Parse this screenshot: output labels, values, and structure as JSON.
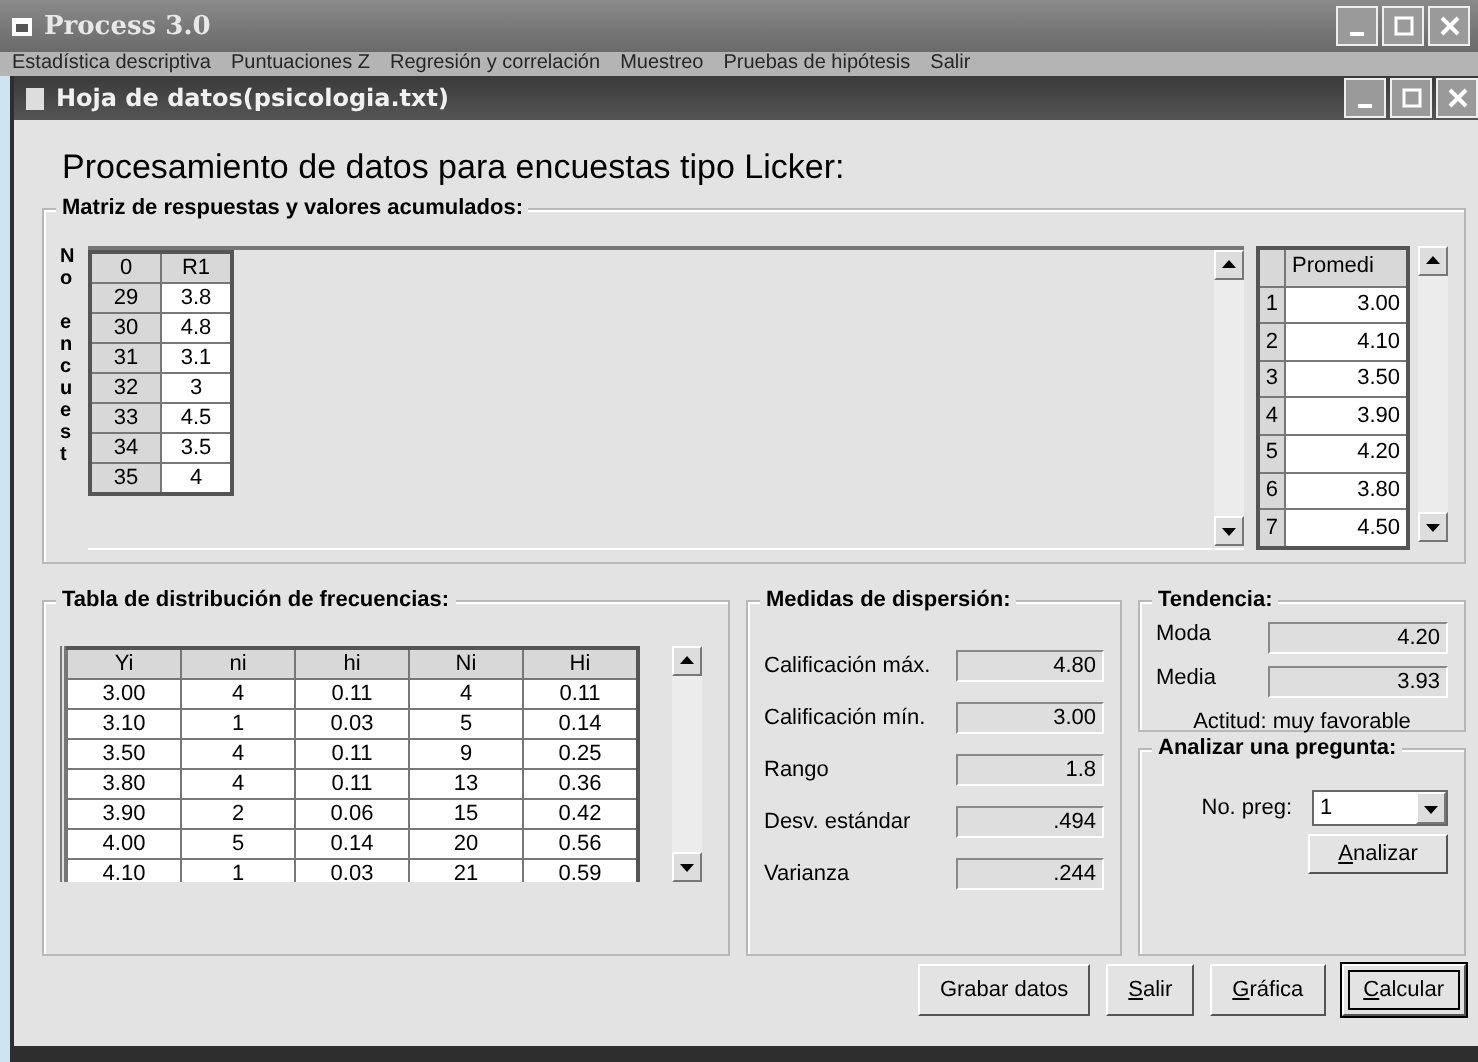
{
  "app_window": {
    "title": "Process 3.0"
  },
  "menu": [
    "Estadística descriptiva",
    "Puntuaciones Z",
    "Regresión y correlación",
    "Muestreo",
    "Pruebas de hipótesis",
    "Salir"
  ],
  "document_window": {
    "title": "Hoja de datos(psicologia.txt)"
  },
  "heading": "Procesamiento de datos para encuestas tipo Licker:",
  "response_matrix": {
    "title": "Matriz de respuestas y valores acumulados:",
    "side_label": "No encuest",
    "columns": [
      "0",
      "R1"
    ],
    "rows": [
      [
        "29",
        "3.8"
      ],
      [
        "30",
        "4.8"
      ],
      [
        "31",
        "3.1"
      ],
      [
        "32",
        "3"
      ],
      [
        "33",
        "4.5"
      ],
      [
        "34",
        "3.5"
      ],
      [
        "35",
        "4"
      ]
    ]
  },
  "averages": {
    "column": "Promedi",
    "rows": [
      [
        "1",
        "3.00"
      ],
      [
        "2",
        "4.10"
      ],
      [
        "3",
        "3.50"
      ],
      [
        "4",
        "3.90"
      ],
      [
        "5",
        "4.20"
      ],
      [
        "6",
        "3.80"
      ],
      [
        "7",
        "4.50"
      ]
    ]
  },
  "frequency_table": {
    "title": "Tabla de distribución de frecuencias:",
    "columns": [
      "Yi",
      "ni",
      "hi",
      "Ni",
      "Hi"
    ],
    "rows": [
      [
        "3.00",
        "4",
        "0.11",
        "4",
        "0.11"
      ],
      [
        "3.10",
        "1",
        "0.03",
        "5",
        "0.14"
      ],
      [
        "3.50",
        "4",
        "0.11",
        "9",
        "0.25"
      ],
      [
        "3.80",
        "4",
        "0.11",
        "13",
        "0.36"
      ],
      [
        "3.90",
        "2",
        "0.06",
        "15",
        "0.42"
      ],
      [
        "4.00",
        "5",
        "0.14",
        "20",
        "0.56"
      ],
      [
        "4.10",
        "1",
        "0.03",
        "21",
        "0.59"
      ]
    ]
  },
  "dispersion": {
    "title": "Medidas de dispersión:",
    "fields": [
      {
        "label": "Calificación máx.",
        "value": "4.80"
      },
      {
        "label": "Calificación mín.",
        "value": "3.00"
      },
      {
        "label": "Rango",
        "value": "1.8"
      },
      {
        "label": "Desv. estándar",
        "value": ".494"
      },
      {
        "label": "Varianza",
        "value": ".244"
      }
    ]
  },
  "tendency": {
    "title": "Tendencia:",
    "fields": [
      {
        "label": "Moda",
        "value": "4.20"
      },
      {
        "label": "Media",
        "value": "3.93"
      }
    ],
    "attitude": "Actitud: muy favorable"
  },
  "analyze": {
    "title": "Analizar una pregunta:",
    "label": "No. preg:",
    "value": "1",
    "button": {
      "label": "Analizar",
      "underline": true
    }
  },
  "buttons": [
    {
      "label": "Grabar datos",
      "default": false
    },
    {
      "label": "Salir",
      "underline": true,
      "default": false
    },
    {
      "label": "Gráfica",
      "underline": true,
      "default": false
    },
    {
      "label": "Calcular",
      "underline": true,
      "default": true
    }
  ]
}
